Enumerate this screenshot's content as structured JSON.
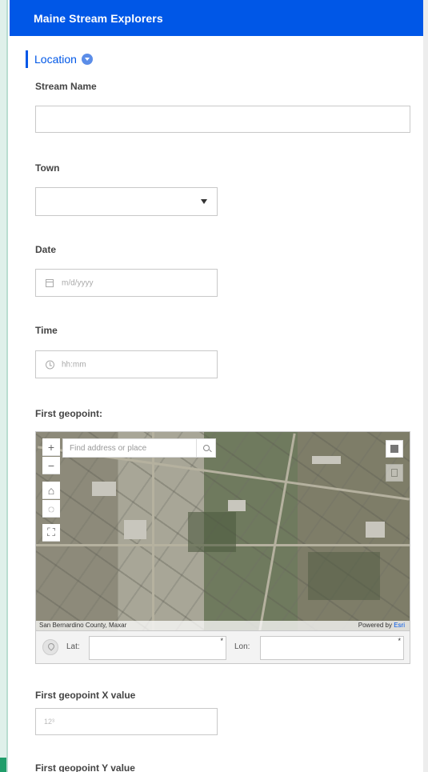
{
  "header": {
    "title": "Maine Stream Explorers"
  },
  "section": {
    "title": "Location"
  },
  "fields": {
    "stream_name": {
      "label": "Stream Name",
      "value": ""
    },
    "town": {
      "label": "Town",
      "value": ""
    },
    "date": {
      "label": "Date",
      "placeholder": "m/d/yyyy"
    },
    "time": {
      "label": "Time",
      "placeholder": "hh:mm"
    },
    "geopoint": {
      "label": "First geopoint:"
    },
    "geopoint_x": {
      "label": "First geopoint X value",
      "icon_text": "12³"
    },
    "geopoint_y": {
      "label": "First geopoint Y value"
    }
  },
  "map": {
    "search_placeholder": "Find address or place",
    "attribution": "San Bernardino County, Maxar",
    "powered_by": "Powered by ",
    "powered_brand": "Esri",
    "controls": [
      {
        "name": "zoom-in",
        "glyph": "+"
      },
      {
        "name": "zoom-out",
        "glyph": "−"
      },
      {
        "name": "home",
        "glyph": "⌂"
      },
      {
        "name": "locate",
        "glyph": "◌"
      },
      {
        "name": "fullscreen",
        "glyph": "⛶"
      }
    ],
    "lat_label": "Lat:",
    "lon_label": "Lon:",
    "required_mark": "*"
  },
  "colors": {
    "brand": "#0057e7",
    "rail": "#1f9d6a"
  }
}
